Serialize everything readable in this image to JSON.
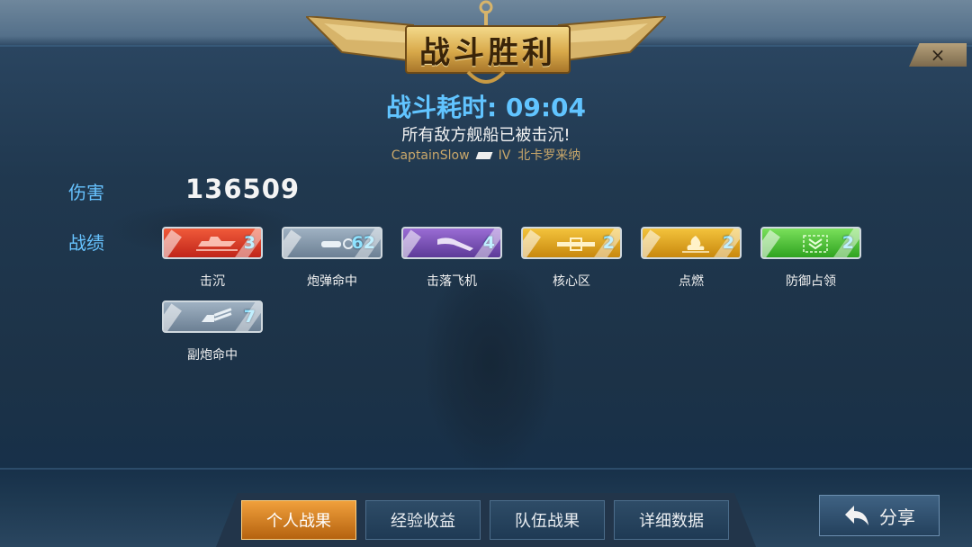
{
  "banner": {
    "title": "战斗胜利"
  },
  "close": {
    "icon": "close-icon",
    "label": "×"
  },
  "battle": {
    "duration_text": "战斗耗时: 09:04",
    "result_text": "所有敌方舰船已被击沉!",
    "player_name": "CaptainSlow",
    "ship_tier": "IV",
    "ship_name": "北卡罗来纳"
  },
  "damage": {
    "label": "伤害",
    "value": "136509"
  },
  "record": {
    "label": "战绩",
    "medals": [
      {
        "name": "击沉",
        "count": "3",
        "color": "#d8362a",
        "icon": "ship-sunk-icon"
      },
      {
        "name": "炮弹命中",
        "count": "62",
        "color": "#8a9db0",
        "icon": "shell-hit-icon"
      },
      {
        "name": "击落飞机",
        "count": "4",
        "color": "#7a52b8",
        "icon": "plane-down-icon"
      },
      {
        "name": "核心区",
        "count": "2",
        "color": "#e0a21e",
        "icon": "citadel-icon"
      },
      {
        "name": "点燃",
        "count": "2",
        "color": "#e0a21e",
        "icon": "fire-icon"
      },
      {
        "name": "防御占领",
        "count": "2",
        "color": "#4cc432",
        "icon": "defend-base-icon"
      },
      {
        "name": "副炮命中",
        "count": "7",
        "color": "#8a9db0",
        "icon": "secondary-hit-icon"
      }
    ]
  },
  "tabs": [
    {
      "label": "个人战果",
      "active": true
    },
    {
      "label": "经验收益",
      "active": false
    },
    {
      "label": "队伍战果",
      "active": false
    },
    {
      "label": "详细数据",
      "active": false
    }
  ],
  "share": {
    "label": "分享",
    "icon": "share-arrow-icon"
  }
}
